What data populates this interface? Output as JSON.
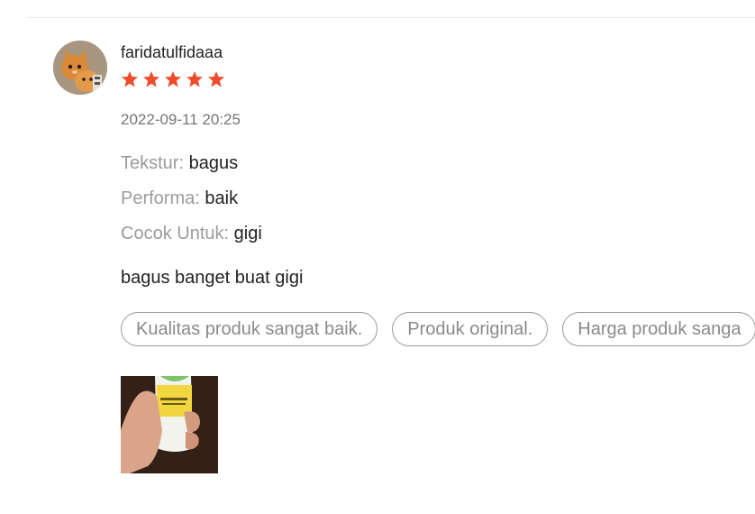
{
  "review": {
    "username": "faridatulfidaaa",
    "rating": 5,
    "timestamp": "2022-09-11 20:25",
    "attributes": [
      {
        "key": "Tekstur:",
        "value": "bagus"
      },
      {
        "key": "Performa:",
        "value": "baik"
      },
      {
        "key": "Cocok Untuk:",
        "value": "gigi"
      }
    ],
    "comment": "bagus banget buat gigi",
    "tags": [
      "Kualitas produk sangat baik.",
      "Produk original.",
      "Harga produk sanga"
    ],
    "star_color": "#ee4d2d",
    "avatar_icon": "cat-avatar",
    "photo_icon": "product-photo"
  }
}
